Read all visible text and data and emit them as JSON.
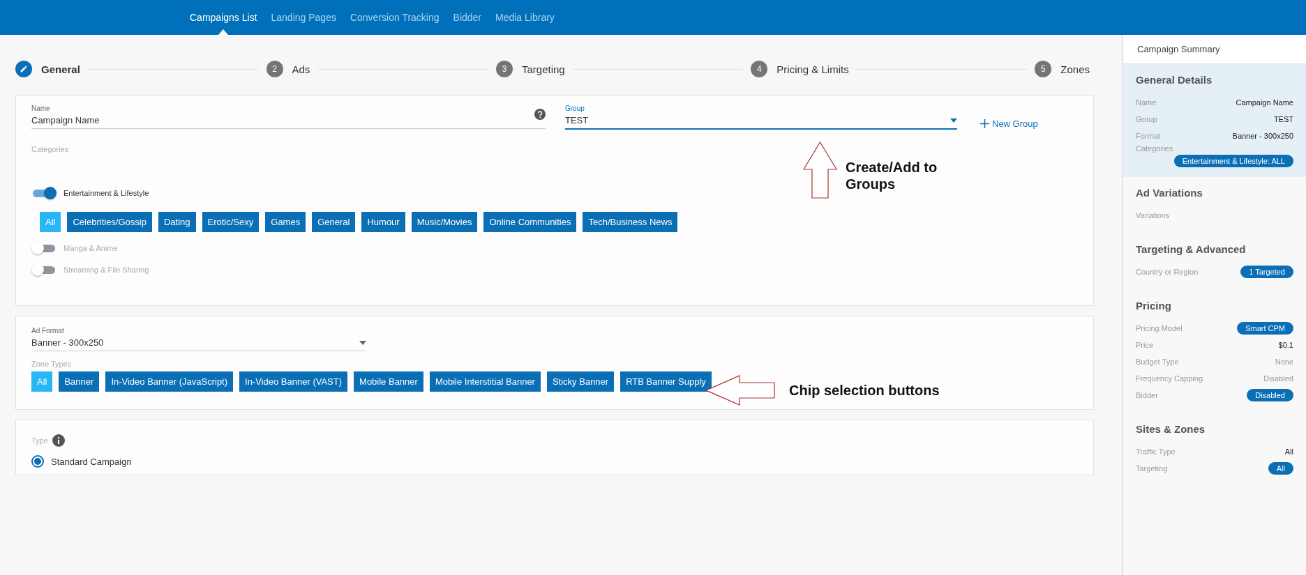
{
  "top_nav": [
    {
      "label": "Campaigns List",
      "selected": true
    },
    {
      "label": "Landing Pages",
      "selected": false
    },
    {
      "label": "Conversion Tracking",
      "selected": false
    },
    {
      "label": "Bidder",
      "selected": false
    },
    {
      "label": "Media Library",
      "selected": false
    }
  ],
  "stepper": [
    {
      "label": "General",
      "selected": true
    },
    {
      "number": "2",
      "label": "Ads",
      "selected": false
    },
    {
      "number": "3",
      "label": "Targeting",
      "selected": false
    },
    {
      "number": "4",
      "label": "Pricing & Limits",
      "selected": false
    },
    {
      "number": "5",
      "label": "Zones",
      "selected": false
    }
  ],
  "general_card": {
    "name_field": {
      "label": "Name",
      "value": "Campaign Name"
    },
    "group_field": {
      "label": "Group",
      "value": "TEST"
    },
    "new_group_link": "New Group",
    "categories_label": "Categories",
    "categories": [
      {
        "label": "Entertainment & Lifestyle",
        "on": true,
        "chips": [
          {
            "label": "All",
            "selected": true
          },
          {
            "label": "Celebrities/Gossip",
            "selected": false
          },
          {
            "label": "Dating",
            "selected": false
          },
          {
            "label": "Erotic/Sexy",
            "selected": false
          },
          {
            "label": "Games",
            "selected": false
          },
          {
            "label": "General",
            "selected": false
          },
          {
            "label": "Humour",
            "selected": false
          },
          {
            "label": "Music/Movies",
            "selected": false
          },
          {
            "label": "Online Communities",
            "selected": false
          },
          {
            "label": "Tech/Business News",
            "selected": false
          }
        ]
      },
      {
        "label": "Manga & Anime",
        "on": false
      },
      {
        "label": "Streaming & File Sharing",
        "on": false
      }
    ],
    "annotation": {
      "kind": "up-arrow",
      "text": "Create/Add to Groups"
    }
  },
  "format_card": {
    "ad_format": {
      "label": "Ad Format",
      "value": "Banner - 300x250"
    },
    "zone_types_label": "Zone Types",
    "zone_chips": [
      {
        "label": "All",
        "selected": true
      },
      {
        "label": "Banner",
        "selected": false
      },
      {
        "label": "In-Video Banner (JavaScript)",
        "selected": false
      },
      {
        "label": "In-Video Banner (VAST)",
        "selected": false
      },
      {
        "label": "Mobile Banner",
        "selected": false
      },
      {
        "label": "Mobile Interstitial Banner",
        "selected": false
      },
      {
        "label": "Sticky Banner",
        "selected": false
      },
      {
        "label": "RTB Banner Supply",
        "selected": false
      }
    ],
    "annotation": {
      "kind": "left-arrow",
      "text": "Chip selection buttons"
    }
  },
  "type_card": {
    "type_label": "Type",
    "options": [
      {
        "label": "Standard Campaign",
        "selected": true
      }
    ]
  },
  "summary": {
    "title": "Campaign Summary",
    "sections": [
      {
        "heading": "General Details",
        "highlighted": true,
        "rows": [
          {
            "label": "Name",
            "value": "Campaign Name",
            "kind": "text"
          },
          {
            "label": "Group",
            "value": "TEST",
            "kind": "text"
          },
          {
            "label": "Format",
            "value": "Banner - 300x250",
            "kind": "text"
          },
          {
            "label": "Categories",
            "value": "Entertainment & Lifestyle: ALL",
            "kind": "pill-below"
          }
        ]
      },
      {
        "heading": "Ad Variations",
        "highlighted": false,
        "rows": [
          {
            "label": "Variations",
            "kind": "text"
          }
        ]
      },
      {
        "heading": "Targeting & Advanced",
        "highlighted": false,
        "rows": [
          {
            "label": "Country or Region",
            "value": "1 Targeted",
            "kind": "pill"
          }
        ]
      },
      {
        "heading": "Pricing",
        "highlighted": false,
        "rows": [
          {
            "label": "Pricing Model",
            "value": "Smart CPM",
            "kind": "pill"
          },
          {
            "label": "Price",
            "value": "$0.1",
            "kind": "text"
          },
          {
            "label": "Budget Type",
            "value": "None",
            "kind": "muted"
          },
          {
            "label": "Frequency Capping",
            "value": "Disabled",
            "kind": "muted"
          },
          {
            "label": "Bidder",
            "value": "Disabled",
            "kind": "pill"
          }
        ]
      },
      {
        "heading": "Sites & Zones",
        "highlighted": false,
        "rows": [
          {
            "label": "Traffic Type",
            "value": "All",
            "kind": "text"
          },
          {
            "label": "Targeting",
            "value": "All",
            "kind": "pill"
          }
        ]
      }
    ]
  }
}
